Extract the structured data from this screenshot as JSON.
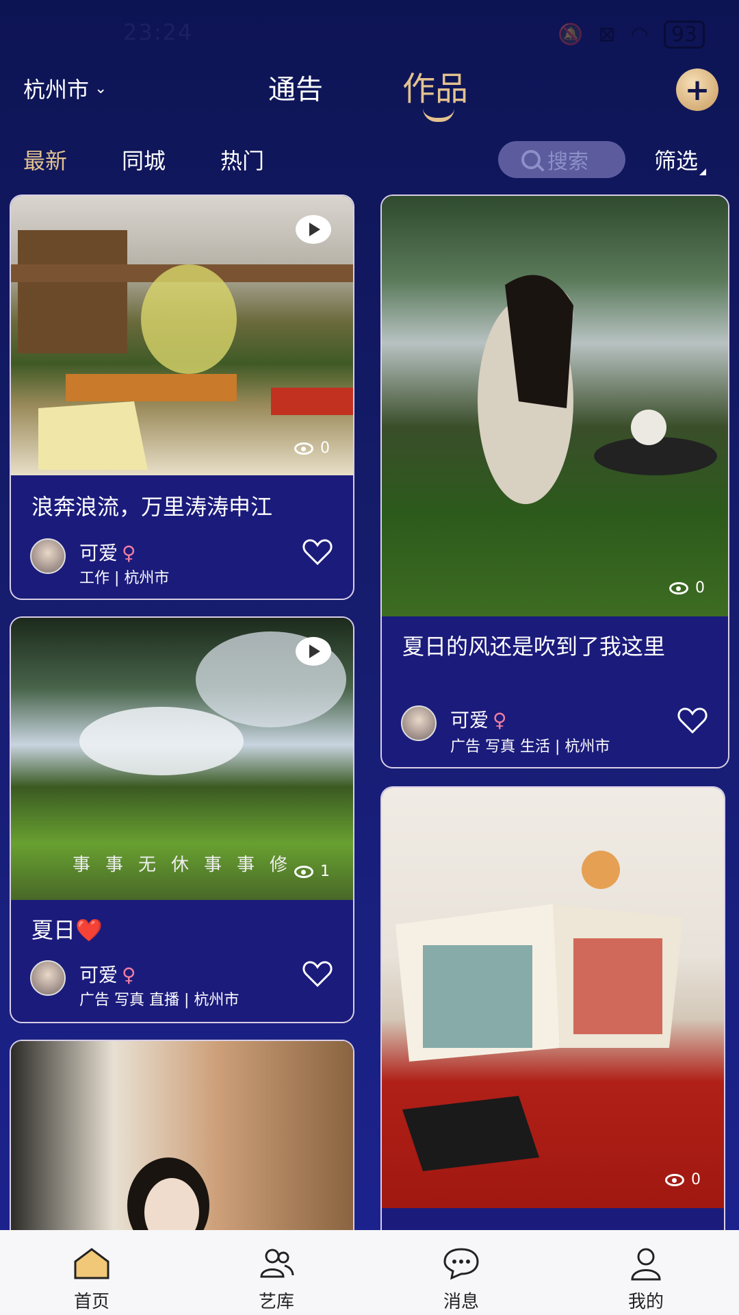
{
  "status_bar": {
    "time": "23:24",
    "battery": "93"
  },
  "header": {
    "city": "杭州市",
    "tabs": [
      "通告",
      "作品"
    ],
    "active_tab": "作品"
  },
  "filters": {
    "tabs": [
      "最新",
      "同城",
      "热门"
    ],
    "active": "最新",
    "search_placeholder": "搜索",
    "filter_label": "筛选"
  },
  "cards": [
    {
      "title": "浪奔浪流，万里涛涛申江",
      "views": "0",
      "author": "可爱",
      "gender": "♀",
      "tags": "工作 | 杭州市",
      "video": true
    },
    {
      "title": "夏日的风还是吹到了我这里",
      "views": "0",
      "author": "可爱",
      "gender": "♀",
      "tags": "广告 写真 生活 | 杭州市",
      "video": false
    },
    {
      "title": "夏日❤️",
      "views": "1",
      "author": "可爱",
      "gender": "♀",
      "tags": "广告 写真 直播 | 杭州市",
      "video": true,
      "overlay_text": "事事无休事事修"
    },
    {
      "views": "0",
      "video": false
    },
    {
      "video": false
    }
  ],
  "bottom_nav": [
    {
      "label": "首页",
      "icon": "home-icon",
      "active": true
    },
    {
      "label": "艺库",
      "icon": "people-icon",
      "active": false
    },
    {
      "label": "消息",
      "icon": "chat-icon",
      "active": false
    },
    {
      "label": "我的",
      "icon": "user-icon",
      "active": false
    }
  ],
  "colors": {
    "accent": "#e3c28f",
    "card_bg": "#1b1b7c",
    "page_bg": "#151c6a"
  }
}
